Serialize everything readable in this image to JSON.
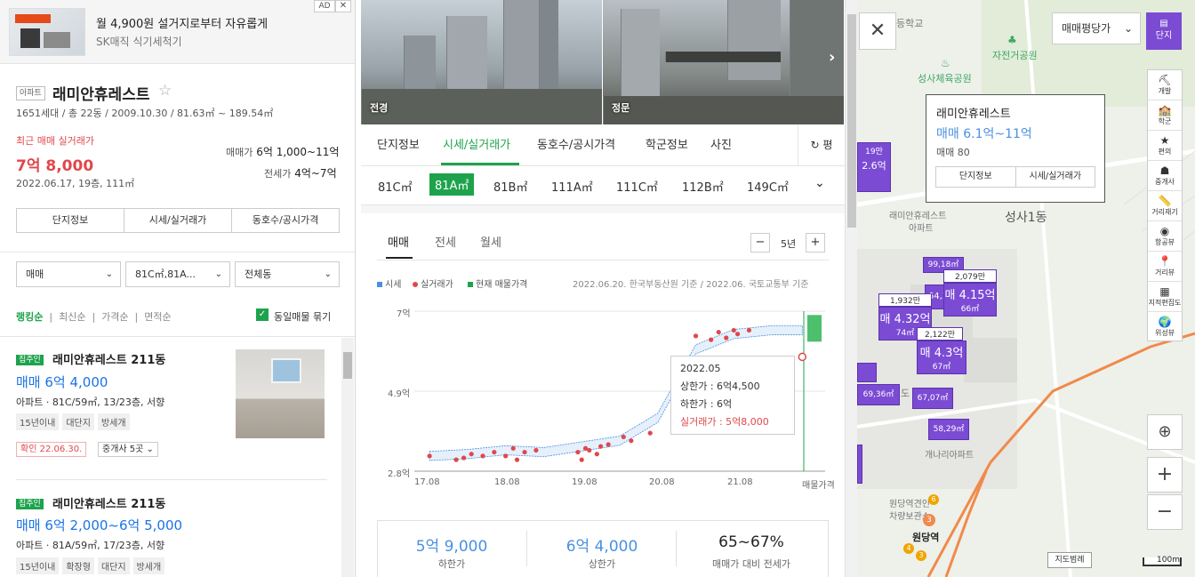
{
  "ad": {
    "title": "월 4,900원 설거지로부터 자유롭게",
    "subtitle": "SK매직 식기세척기",
    "tag": "AD",
    "close": "✕"
  },
  "complex": {
    "type_tag": "아파트",
    "name": "래미안휴레스트",
    "meta": "1651세대 / 총 22동 / 2009.10.30 / 81.63㎡ ~ 189.54㎡",
    "recent_label": "최근 매매 실거래가",
    "recent_price": "7억 8,000",
    "recent_date": "2022.06.17, 19층, 111㎡",
    "sale_label": "매매가",
    "sale_value": "6억 1,000~11억",
    "jeonse_label": "전세가",
    "jeonse_value": "4억~7억",
    "tabs": [
      "단지정보",
      "시세/실거래가",
      "동호수/공시가격"
    ]
  },
  "filters": {
    "trade": "매매",
    "area": "81C㎡,81A...",
    "dong": "전체동"
  },
  "sort": {
    "items": [
      "랭킹순",
      "최신순",
      "가격순",
      "면적순"
    ],
    "group_label": "동일매물 묶기"
  },
  "listings": [
    {
      "badge": "집주인",
      "name": "래미안휴레스트 211동",
      "price": "매매 6억 4,000",
      "desc": "아파트 · 81C/59㎡, 13/23층, 서향",
      "chips": [
        "15년이내",
        "대단지",
        "방세개"
      ],
      "confirm": "확인 22.06.30.",
      "agent": "중개사 5곳"
    },
    {
      "badge": "집주인",
      "name": "래미안휴레스트 211동",
      "price": "매매 6억 2,000~6억 5,000",
      "desc": "아파트 · 81A/59㎡, 17/23층, 서향",
      "chips": [
        "15년이내",
        "확장형",
        "대단지",
        "방세개"
      ]
    }
  ],
  "photos": [
    {
      "label": "전경"
    },
    {
      "label": "정문"
    }
  ],
  "mid_tabs": [
    "단지정보",
    "시세/실거래가",
    "동호수/공시가격",
    "학군정보",
    "사진"
  ],
  "refresh_label": "평",
  "sizes": [
    "81C㎡",
    "81A㎡",
    "81B㎡",
    "111A㎡",
    "111C㎡",
    "112B㎡",
    "149C㎡"
  ],
  "price_tabs": [
    "매매",
    "전세",
    "월세"
  ],
  "period": "5년",
  "legend": [
    {
      "label": "시세",
      "color": "#4a90e2"
    },
    {
      "label": "실거래가",
      "color": "#e0474c"
    },
    {
      "label": "현재 매물가격",
      "color": "#1ea34c"
    }
  ],
  "basis": "2022.06.20. 한국부동산원 기준 / 2022.06. 국토교통부 기준",
  "chart_data": {
    "type": "scatter",
    "y_ticks": [
      "7억",
      "4.9억",
      "2.8억"
    ],
    "x_ticks": [
      "17.08",
      "18.08",
      "19.08",
      "20.08",
      "21.08",
      "매물가격"
    ],
    "ylim": [
      2.8,
      7
    ],
    "xlim": [
      2017.3,
      2022.7
    ],
    "series": [
      {
        "name": "실거래가",
        "color": "#e0474c",
        "points": [
          [
            2017.5,
            3.2
          ],
          [
            2017.85,
            3.1
          ],
          [
            2017.95,
            3.15
          ],
          [
            2018.05,
            3.25
          ],
          [
            2018.2,
            3.2
          ],
          [
            2018.35,
            3.3
          ],
          [
            2018.5,
            3.2
          ],
          [
            2018.6,
            3.4
          ],
          [
            2018.65,
            3.1
          ],
          [
            2018.75,
            3.3
          ],
          [
            2018.9,
            3.35
          ],
          [
            2019.45,
            3.3
          ],
          [
            2019.5,
            3.1
          ],
          [
            2019.55,
            3.4
          ],
          [
            2019.6,
            3.35
          ],
          [
            2019.7,
            3.25
          ],
          [
            2019.75,
            3.45
          ],
          [
            2019.85,
            3.5
          ],
          [
            2020.05,
            3.7
          ],
          [
            2020.15,
            3.6
          ],
          [
            2020.4,
            3.8
          ],
          [
            2021.0,
            6.35
          ],
          [
            2021.2,
            6.25
          ],
          [
            2021.3,
            6.45
          ],
          [
            2021.4,
            6.3
          ],
          [
            2021.5,
            6.5
          ],
          [
            2021.55,
            6.4
          ],
          [
            2021.7,
            6.5
          ],
          [
            2022.4,
            5.8
          ]
        ]
      },
      {
        "name": "시세",
        "color": "#4a90e2",
        "points": [
          [
            2017.5,
            3.2
          ],
          [
            2018.0,
            3.25
          ],
          [
            2018.5,
            3.35
          ],
          [
            2019.0,
            3.3
          ],
          [
            2019.5,
            3.45
          ],
          [
            2020.0,
            3.6
          ],
          [
            2020.5,
            4.2
          ],
          [
            2021.0,
            6.0
          ],
          [
            2021.5,
            6.4
          ],
          [
            2022.0,
            6.5
          ],
          [
            2022.4,
            6.5
          ]
        ]
      }
    ],
    "listing_range": [
      6.2,
      6.9
    ]
  },
  "tooltip": {
    "date": "2022.05",
    "upper": "상한가 : 6억4,500",
    "lower": "하한가 : 6억",
    "deal": "실거래가 : 5억8,000"
  },
  "stats": [
    {
      "value": "5억 9,000",
      "label": "하한가"
    },
    {
      "value": "6억 4,000",
      "label": "상한가"
    },
    {
      "value": "65~67%",
      "label": "매매가 대비 전세가"
    }
  ],
  "map": {
    "type_select": "매매평당가",
    "danji_btn": "단지",
    "tools": [
      {
        "icon": "⛏",
        "label": "개발"
      },
      {
        "icon": "🏫",
        "label": "학군"
      },
      {
        "icon": "★",
        "label": "편의"
      },
      {
        "icon": "☗",
        "label": "중개사"
      },
      {
        "icon": "📏",
        "label": "거리재기"
      },
      {
        "icon": "◉",
        "label": "항공뷰"
      },
      {
        "icon": "📍",
        "label": "거리뷰"
      },
      {
        "icon": "▦",
        "label": "지적편집도"
      },
      {
        "icon": "🌍",
        "label": "위성뷰"
      }
    ],
    "info": {
      "name": "래미안휴레스트",
      "price": "매매 6.1억~11억",
      "count": "매매 80",
      "btns": [
        "단지정보",
        "시세/실거래가"
      ]
    },
    "places": [
      "자전거공원",
      "성사체육공원",
      "등학교",
      "성사1동",
      "래미안휴레스트",
      "아파트",
      "개나리아파트",
      "원당역견인",
      "차량보관소",
      "원당역"
    ],
    "markers": [
      {
        "top": "1,932만",
        "main": "매 4.32억",
        "sub": "74㎡"
      },
      {
        "top": "2,079만",
        "main": "매 4.15억",
        "sub": "66㎡"
      },
      {
        "top": "2,122만",
        "main": "매 4.3억",
        "sub": "67㎡"
      }
    ],
    "small_markers": [
      "99,18㎡",
      "64,3",
      "69,36㎡",
      "67,07㎡",
      "58,29㎡",
      "19만",
      "2.6억",
      "도"
    ],
    "legend_btn": "지도범례",
    "scale": "100m"
  }
}
